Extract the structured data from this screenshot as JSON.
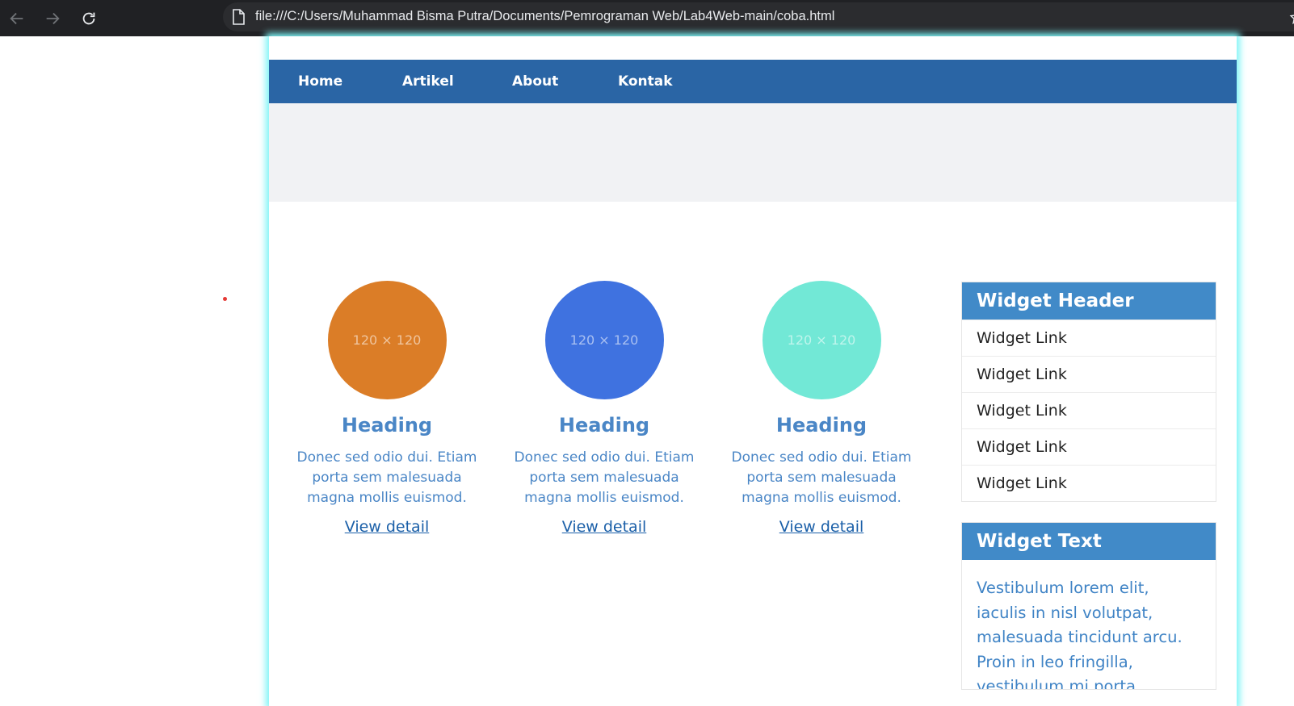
{
  "browser": {
    "url": "file:///C:/Users/Muhammad Bisma Putra/Documents/Pemrograman Web/Lab4Web-main/coba.html"
  },
  "nav": {
    "items": [
      {
        "label": "Home"
      },
      {
        "label": "Artikel"
      },
      {
        "label": "About"
      },
      {
        "label": "Kontak"
      }
    ]
  },
  "cards": [
    {
      "placeholder": "120 × 120",
      "color": "#db7d27",
      "heading": "Heading",
      "text": "Donec sed odio dui. Etiam porta sem malesuada magna mollis euismod.",
      "link": "View detail"
    },
    {
      "placeholder": "120 × 120",
      "color": "#3f72e0",
      "heading": "Heading",
      "text": "Donec sed odio dui. Etiam porta sem malesuada magna mollis euismod.",
      "link": "View detail"
    },
    {
      "placeholder": "120 × 120",
      "color": "#72e8d6",
      "heading": "Heading",
      "text": "Donec sed odio dui. Etiam porta sem malesuada magna mollis euismod.",
      "link": "View detail"
    }
  ],
  "widgets": {
    "links_header": "Widget Header",
    "links": [
      "Widget Link",
      "Widget Link",
      "Widget Link",
      "Widget Link",
      "Widget Link"
    ],
    "text_header": "Widget Text",
    "text_body": "Vestibulum lorem elit, iaculis in nisl volutpat, malesuada tincidunt arcu. Proin in leo fringilla, vestibulum mi porta, faucibus felis. Integer pharetra"
  }
}
